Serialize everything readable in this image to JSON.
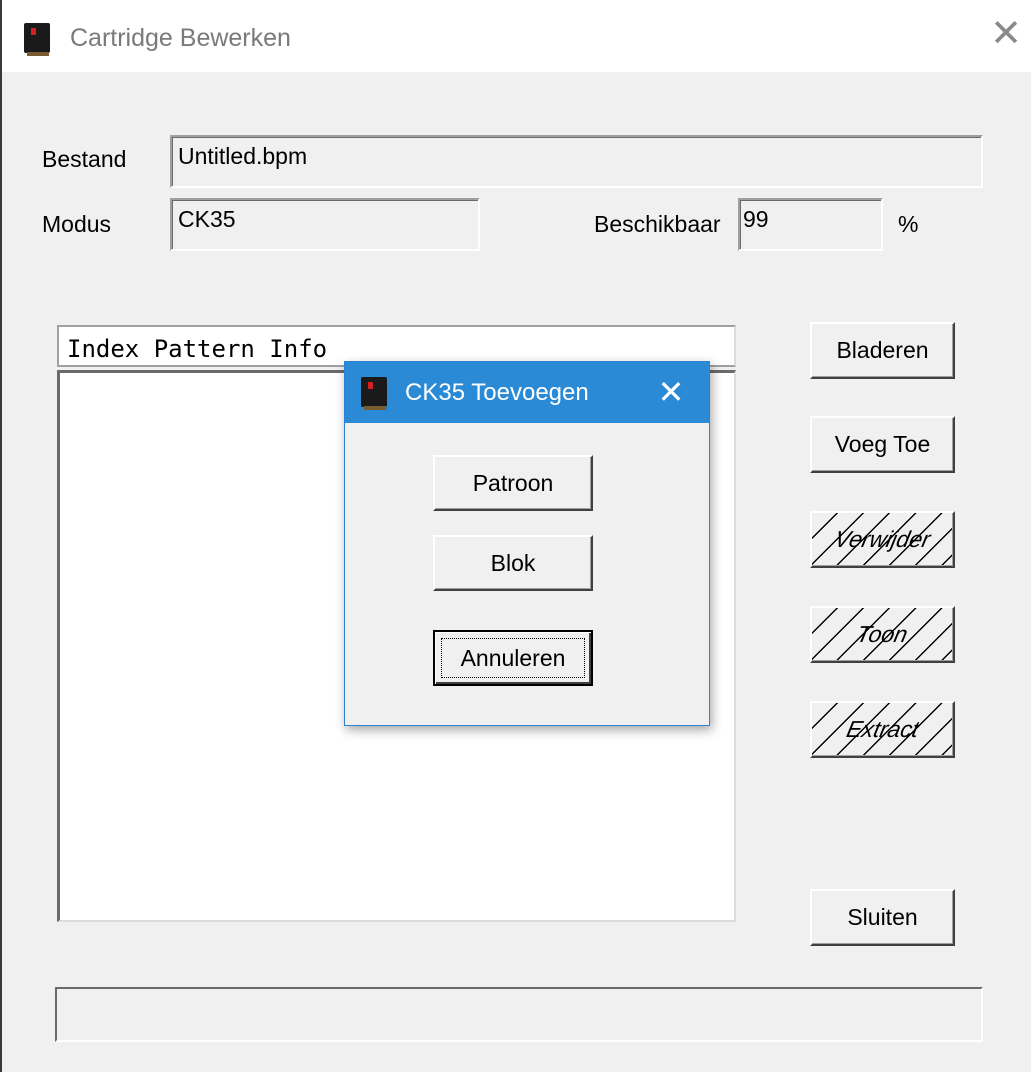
{
  "window": {
    "title": "Cartridge Bewerken",
    "close_glyph": "✕",
    "icon": "cartridge-app-icon"
  },
  "form": {
    "file_label": "Bestand",
    "file_value": "Untitled.bpm",
    "mode_label": "Modus",
    "mode_value": "CK35",
    "available_label": "Beschikbaar",
    "available_value": "99",
    "available_unit": "%"
  },
  "list": {
    "header": "Index Pattern Info",
    "items": []
  },
  "buttons": {
    "browse": "Bladeren",
    "add": "Voeg Toe",
    "delete": "Verwijder",
    "show": "Toon",
    "extract": "Extract",
    "close": "Sluiten"
  },
  "status": {
    "text": ""
  },
  "dialog": {
    "title": "CK35 Toevoegen",
    "close_glyph": "✕",
    "pattern_button": "Patroon",
    "block_button": "Blok",
    "cancel_button": "Annuleren"
  },
  "colors": {
    "dialog_titlebar": "#2b8ad6",
    "window_background": "#f0f0f0"
  }
}
